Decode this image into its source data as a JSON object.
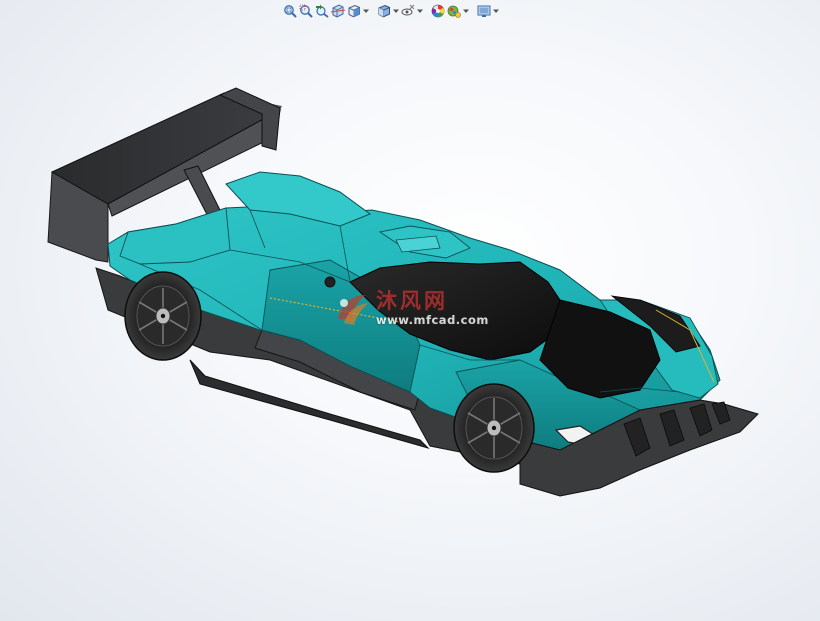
{
  "toolbar": {
    "buttons": [
      {
        "icon": "zoom-to-fit-icon",
        "dropdown": false
      },
      {
        "icon": "zoom-to-area-icon",
        "dropdown": false
      },
      {
        "icon": "previous-view-icon",
        "dropdown": false
      },
      {
        "icon": "section-view-icon",
        "dropdown": false
      },
      {
        "icon": "view-orientation-icon",
        "dropdown": true
      },
      {
        "icon": "display-style-icon",
        "dropdown": true
      },
      {
        "icon": "hide-show-items-icon",
        "dropdown": true
      },
      {
        "icon": "edit-appearance-icon",
        "dropdown": false
      },
      {
        "icon": "apply-scene-icon",
        "dropdown": true
      },
      {
        "icon": "view-settings-icon",
        "dropdown": true
      }
    ]
  },
  "model": {
    "name": "race-car-3d-model",
    "body_color": "#1fb3b6",
    "carbon_color": "#3a3b3d",
    "glass_color": "#141414"
  },
  "watermark": {
    "brand_cn": "沐风网",
    "url": "www.mfcad.com",
    "color": "#b8312f"
  }
}
